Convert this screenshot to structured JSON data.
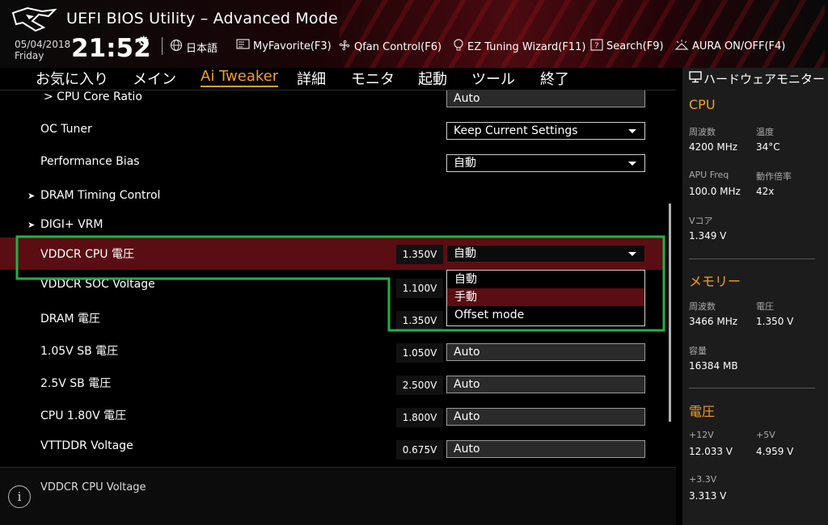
{
  "header": {
    "title": "UEFI BIOS Utility – Advanced Mode",
    "date": "05/04/2018",
    "day": "Friday",
    "time": "21:52",
    "toolbar": [
      {
        "icon": "globe-icon",
        "label": "日本語"
      },
      {
        "icon": "favorite-icon",
        "label": "MyFavorite(F3)"
      },
      {
        "icon": "fan-icon",
        "label": "Qfan Control(F6)"
      },
      {
        "icon": "bulb-icon",
        "label": "EZ Tuning Wizard(F11)"
      },
      {
        "icon": "question-icon",
        "label": "Search(F9)"
      },
      {
        "icon": "aura-icon",
        "label": "AURA ON/OFF(F4)"
      }
    ]
  },
  "nav": {
    "tabs": [
      "お気に入り",
      "メイン",
      "Ai Tweaker",
      "詳細",
      "モニタ",
      "起動",
      "ツール",
      "終了"
    ],
    "active": "Ai Tweaker"
  },
  "settings": {
    "cpu_core_ratio": {
      "label": "> CPU Core Ratio",
      "value": "Auto"
    },
    "oc_tuner": {
      "label": "OC Tuner",
      "value": "Keep Current Settings"
    },
    "performance_bias": {
      "label": "Performance Bias",
      "value": "自動"
    },
    "dram_timing": {
      "label": "DRAM Timing Control"
    },
    "digi_vrm": {
      "label": "DIGI+ VRM"
    },
    "vddcr_cpu": {
      "label": "VDDCR CPU 電圧",
      "current": "1.350V",
      "value": "自動"
    },
    "vddcr_soc": {
      "label": "VDDCR SOC Voltage",
      "current": "1.100V"
    },
    "dram_voltage": {
      "label": "DRAM 電圧",
      "current": "1.350V"
    },
    "sb_105": {
      "label": "1.05V SB 電圧",
      "current": "1.050V",
      "value": "Auto"
    },
    "sb_25": {
      "label": "2.5V SB 電圧",
      "current": "2.500V",
      "value": "Auto"
    },
    "cpu_180": {
      "label": "CPU 1.80V 電圧",
      "current": "1.800V",
      "value": "Auto"
    },
    "vttddr": {
      "label": "VTTDDR Voltage",
      "current": "0.675V",
      "value": "Auto"
    }
  },
  "dropdown": {
    "options": [
      "自動",
      "手動",
      "Offset mode"
    ],
    "hovered": "手動"
  },
  "help": {
    "text": "VDDCR CPU Voltage"
  },
  "hwmon": {
    "title": "ハードウェアモニター",
    "cpu": {
      "heading": "CPU",
      "freq_label": "周波数",
      "freq": "4200 MHz",
      "temp_label": "温度",
      "temp": "34°C",
      "apu_label": "APU Freq",
      "apu": "100.0 MHz",
      "ratio_label": "動作倍率",
      "ratio": "42x",
      "vcore_label": "Vコア",
      "vcore": "1.349 V"
    },
    "memory": {
      "heading": "メモリー",
      "freq_label": "周波数",
      "freq": "3466 MHz",
      "volt_label": "電圧",
      "volt": "1.350 V",
      "cap_label": "容量",
      "cap": "16384 MB"
    },
    "voltage": {
      "heading": "電圧",
      "v12_label": "+12V",
      "v12": "12.033 V",
      "v5_label": "+5V",
      "v5": "4.959 V",
      "v33_label": "+3.3V",
      "v33": "3.313 V"
    }
  },
  "colors": {
    "accent": "#f0a020",
    "highlight": "#5a0d12",
    "annotation": "#22b04a"
  }
}
